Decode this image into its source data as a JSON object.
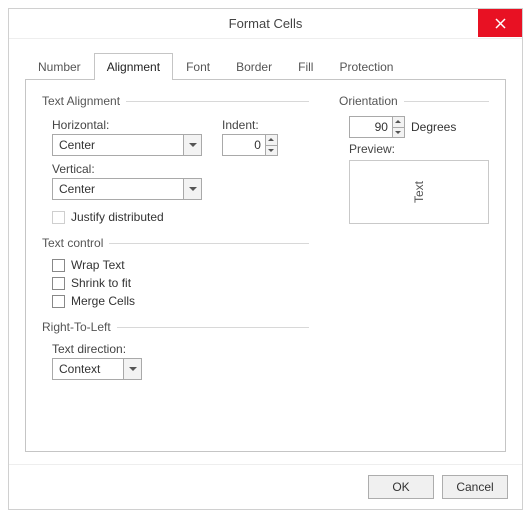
{
  "title": "Format Cells",
  "tabs": [
    "Number",
    "Alignment",
    "Font",
    "Border",
    "Fill",
    "Protection"
  ],
  "active_tab": 1,
  "text_alignment": {
    "heading": "Text Alignment",
    "horizontal_label": "Horizontal:",
    "horizontal_value": "Center",
    "vertical_label": "Vertical:",
    "vertical_value": "Center",
    "indent_label": "Indent:",
    "indent_value": "0",
    "justify_label": "Justify distributed"
  },
  "text_control": {
    "heading": "Text control",
    "wrap": "Wrap Text",
    "shrink": "Shrink to fit",
    "merge": "Merge Cells"
  },
  "rtl": {
    "heading": "Right-To-Left",
    "dir_label": "Text direction:",
    "dir_value": "Context"
  },
  "orientation": {
    "heading": "Orientation",
    "degrees_value": "90",
    "degrees_label": "Degrees",
    "preview_label": "Preview:",
    "preview_text": "Text"
  },
  "buttons": {
    "ok": "OK",
    "cancel": "Cancel"
  }
}
